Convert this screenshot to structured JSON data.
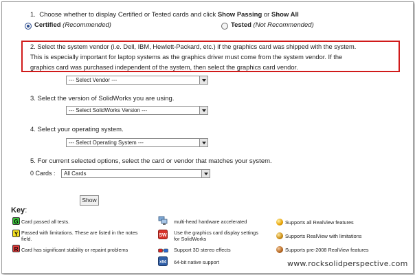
{
  "step1": {
    "number": "1.",
    "prefix": "Choose whether to display Certified or Tested cards and click ",
    "show_passing": "Show Passing",
    "or": " or ",
    "show_all": "Show All",
    "certified_label": "Certified",
    "certified_note": " (Recommended)",
    "tested_label": "Tested",
    "tested_note": " (Not Recommended)"
  },
  "step2": {
    "line1": "2.   Select the system vendor (i.e. Dell, IBM, Hewlett-Packard, etc.) if the graphics card was shipped with the system.",
    "line2": "This is especially important for laptop systems as the graphics driver must come from the system vendor. If the",
    "line3": "graphics card was purchased independent of the system, then select the graphics card vendor.",
    "select": "--- Select Vendor ---"
  },
  "step3": {
    "label": "3.   Select the version of SolidWorks you are using.",
    "select": "--- Select SolidWorks Version ---"
  },
  "step4": {
    "label": "4.   Select your operating system.",
    "select": "--- Select Operating System ---"
  },
  "step5": {
    "label": "5.   For current selected options, select the card or vendor that matches your system.",
    "cards_label": "0 Cards :",
    "select": "All Cards",
    "button": "Show"
  },
  "key": {
    "title": "Key",
    "colon": ":",
    "col1": [
      {
        "badge": "G",
        "color": "#3cc43c",
        "text": "Card passed all tests."
      },
      {
        "badge": "Y",
        "color": "#f4e021",
        "text": "Passed with limitations. These are listed in the notes",
        "text2": "field."
      },
      {
        "badge": "R",
        "color": "#e23a3a",
        "text": "Card has significant stability or repaint problems"
      }
    ],
    "col2": [
      {
        "icon": "multi-head-icon",
        "text": "multi-head hardware accelerated"
      },
      {
        "icon": "sw-settings-icon",
        "text": "Use the graphics card display settings",
        "text2": "for SolidWorks"
      },
      {
        "icon": "stereo-3d-icon",
        "text": "Support 3D stereo effects"
      },
      {
        "icon": "x64-icon",
        "text": "64-bit native support"
      }
    ],
    "col3": [
      {
        "icon": "realview-full-icon",
        "color": "#e8a100",
        "text": "Supports all RealView features"
      },
      {
        "icon": "realview-limited-icon",
        "color": "#c98a10",
        "text": "Supports RealView with limitations"
      },
      {
        "icon": "realview-pre2008-icon",
        "color": "#b5651d",
        "text": "Supports pre-2008 RealView features"
      }
    ]
  },
  "watermark": "www.rocksolidperspective.com"
}
